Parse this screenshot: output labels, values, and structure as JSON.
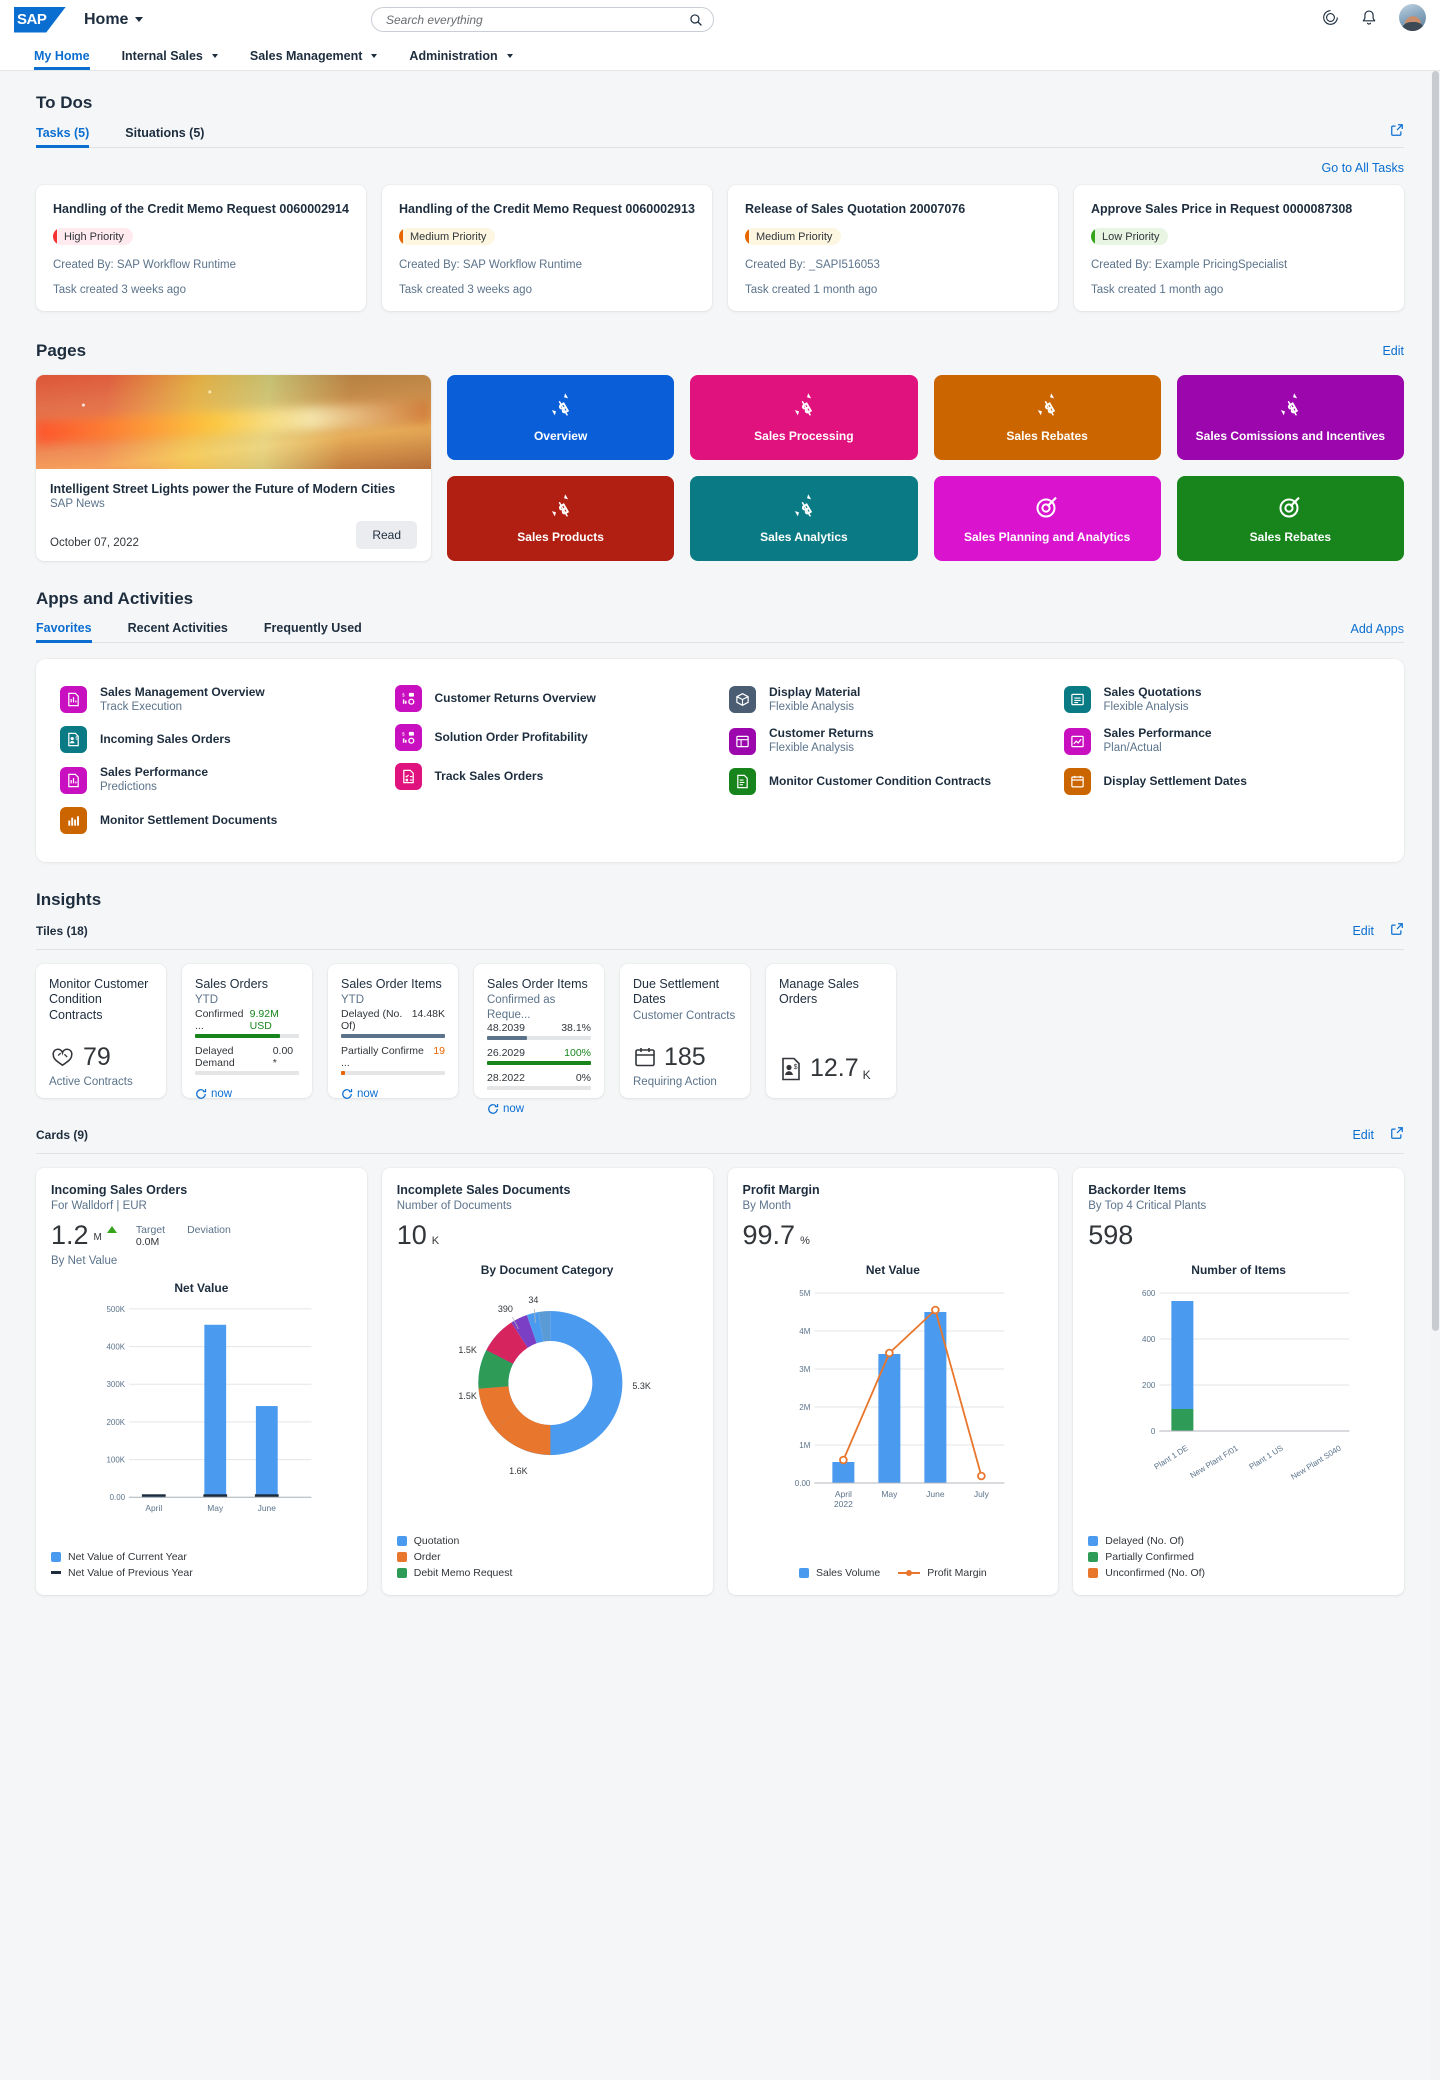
{
  "shell": {
    "logo_text": "SAP",
    "home_title": "Home",
    "search_placeholder": "Search everything",
    "icons": [
      "target-icon",
      "bell-icon",
      "avatar"
    ]
  },
  "nav": {
    "items": [
      {
        "label": "My Home",
        "active": true,
        "has_caret": false
      },
      {
        "label": "Internal Sales",
        "active": false,
        "has_caret": true
      },
      {
        "label": "Sales Management",
        "active": false,
        "has_caret": true
      },
      {
        "label": "Administration",
        "active": false,
        "has_caret": true
      }
    ]
  },
  "todos": {
    "title": "To Dos",
    "tabs": [
      {
        "label": "Tasks (5)",
        "active": true
      },
      {
        "label": "Situations (5)",
        "active": false
      }
    ],
    "go_all_link": "Go to All Tasks",
    "cards": [
      {
        "title": "Handling of the Credit Memo Request 0060002914",
        "priority": "High Priority",
        "priority_level": "high",
        "created_by": "Created By: SAP Workflow Runtime",
        "created_ago": "Task created 3 weeks ago"
      },
      {
        "title": "Handling of the Credit Memo Request 0060002913",
        "priority": "Medium Priority",
        "priority_level": "medium",
        "created_by": "Created By: SAP Workflow Runtime",
        "created_ago": "Task created 3 weeks ago"
      },
      {
        "title": "Release of Sales Quotation 20007076",
        "priority": "Medium Priority",
        "priority_level": "medium",
        "created_by": "Created By: _SAPI516053",
        "created_ago": "Task created 1 month ago"
      },
      {
        "title": "Approve Sales Price in Request 0000087308",
        "priority": "Low Priority",
        "priority_level": "low",
        "created_by": "Created By: Example PricingSpecialist",
        "created_ago": "Task created 1 month ago"
      }
    ]
  },
  "pages": {
    "title": "Pages",
    "edit_label": "Edit",
    "news": {
      "title": "Intelligent Street Lights power the Future of Modern Cities",
      "source": "SAP News",
      "date": "October 07, 2022",
      "read_label": "Read"
    },
    "tiles": [
      {
        "label": "Overview",
        "color": "#0a5ed8",
        "icon": "sales-icon"
      },
      {
        "label": "Sales Processing",
        "color": "#e0127e",
        "icon": "sales-icon"
      },
      {
        "label": "Sales Rebates",
        "color": "#cb6500",
        "icon": "sales-icon"
      },
      {
        "label": "Sales Comissions and Incentives",
        "color": "#9b06ad",
        "icon": "sales-icon"
      },
      {
        "label": "Sales Products",
        "color": "#b11e12",
        "icon": "sales-icon"
      },
      {
        "label": "Sales Analytics",
        "color": "#0a7b84",
        "icon": "sales-icon"
      },
      {
        "label": "Sales Planning and Analytics",
        "color": "#da13cf",
        "icon": "target-icon"
      },
      {
        "label": "Sales Rebates",
        "color": "#18851c",
        "icon": "target-icon"
      }
    ]
  },
  "apps": {
    "title": "Apps and Activities",
    "tabs": [
      {
        "label": "Favorites",
        "active": true
      },
      {
        "label": "Recent Activities",
        "active": false
      },
      {
        "label": "Frequently Used",
        "active": false
      }
    ],
    "add_apps_label": "Add Apps",
    "columns": [
      [
        {
          "name": "Sales Management Overview",
          "sub": "Track Execution",
          "color": "#c910c1",
          "icon": "chart-doc-icon"
        },
        {
          "name": "Incoming Sales Orders",
          "sub": "",
          "color": "#0a7b84",
          "icon": "order-person-icon"
        },
        {
          "name": "Sales Performance",
          "sub": "Predictions",
          "color": "#c910c1",
          "icon": "chart-doc-icon"
        },
        {
          "name": "Monitor Settlement Documents",
          "sub": "",
          "color": "#cb6500",
          "icon": "bar-chart-icon"
        }
      ],
      [
        {
          "name": "Customer Returns Overview",
          "sub": "",
          "color": "#c910c1",
          "icon": "returns-icon"
        },
        {
          "name": "Solution Order Profitability",
          "sub": "",
          "color": "#c910c1",
          "icon": "returns-icon"
        },
        {
          "name": "Track Sales Orders",
          "sub": "",
          "color": "#e0127e",
          "icon": "checklist-icon"
        }
      ],
      [
        {
          "name": "Display Material",
          "sub": "Flexible Analysis",
          "color": "#4a5d73",
          "icon": "material-icon"
        },
        {
          "name": "Customer Returns",
          "sub": "Flexible Analysis",
          "color": "#9b06ad",
          "icon": "grid-icon"
        },
        {
          "name": "Monitor Customer Condition Contracts",
          "sub": "",
          "color": "#18851c",
          "icon": "contract-icon"
        }
      ],
      [
        {
          "name": "Sales Quotations",
          "sub": "Flexible Analysis",
          "color": "#0a7b84",
          "icon": "quote-icon"
        },
        {
          "name": "Sales Performance",
          "sub": "Plan/Actual",
          "color": "#c910c1",
          "icon": "perf-icon"
        },
        {
          "name": "Display Settlement Dates",
          "sub": "",
          "color": "#cb6500",
          "icon": "calendar-icon"
        }
      ]
    ]
  },
  "insights": {
    "title": "Insights",
    "tiles_label": "Tiles (18)",
    "cards_label": "Cards (9)",
    "edit_label": "Edit",
    "tiles": [
      {
        "type": "numeric",
        "title": "Monitor Customer Condition Contracts",
        "sub": "",
        "icon": "contract-icon",
        "value": "79",
        "unit": "",
        "footer": "Active Contracts"
      },
      {
        "type": "bullets",
        "title": "Sales Orders",
        "sub": "YTD",
        "rows": [
          {
            "label": "Confirmed ...",
            "value": "9.92M USD",
            "pct": 82,
            "color": "#18851c",
            "value_color": "#18851c"
          },
          {
            "label": "Delayed Demand",
            "value": "0.00 *",
            "pct": 0,
            "color": "#18851c",
            "value_color": "#32363a"
          }
        ],
        "refresh": "now"
      },
      {
        "type": "bullets",
        "title": "Sales Order Items",
        "sub": "YTD",
        "rows": [
          {
            "label": "Delayed (No. Of)",
            "value": "14.48K",
            "pct": 100,
            "color": "#5b738b",
            "value_color": "#32363a"
          },
          {
            "label": "Partially Confirme ...",
            "value": "19",
            "pct": 4,
            "color": "#e76500",
            "value_color": "#e76500"
          }
        ],
        "refresh": "now"
      },
      {
        "type": "bullets",
        "title": "Sales Order Items",
        "sub": "Confirmed as Reque...",
        "rows": [
          {
            "label": "48.2039",
            "value": "38.1%",
            "pct": 38,
            "color": "#5b738b",
            "value_color": "#32363a"
          },
          {
            "label": "26.2029",
            "value": "100%",
            "pct": 100,
            "color": "#18851c",
            "value_color": "#18851c"
          },
          {
            "label": "28.2022",
            "value": "0%",
            "pct": 0,
            "color": "#5b738b",
            "value_color": "#32363a"
          }
        ],
        "refresh": "now"
      },
      {
        "type": "numeric",
        "title": "Due Settlement Dates",
        "sub": "Customer Contracts",
        "icon": "calendar-icon",
        "value": "185",
        "unit": "",
        "footer": "Requiring Action"
      },
      {
        "type": "numeric",
        "title": "Manage Sales Orders",
        "sub": "",
        "icon": "order-person-icon",
        "value": "12.7",
        "unit": "K",
        "footer": ""
      }
    ]
  },
  "chart_data": [
    {
      "type": "bar",
      "card_title": "Incoming Sales Orders",
      "card_sub": "For Walldorf | EUR",
      "kpi_value": "1.2",
      "kpi_unit_top": "M",
      "kpi_trend": "up",
      "kpi_caption": "By Net Value",
      "meta": [
        {
          "label": "Target",
          "value": "0.0M"
        },
        {
          "label": "Deviation",
          "value": ""
        }
      ],
      "title": "Net Value",
      "xlabel": "",
      "ylabel": "",
      "categories": [
        "April",
        "May",
        "June"
      ],
      "series": [
        {
          "name": "Net Value of Current Year",
          "color": "#4a9bf0",
          "values": [
            2000,
            458000,
            243000
          ]
        },
        {
          "name": "Net Value of Previous Year",
          "color": "#1d2d3e",
          "values": [
            3000,
            3000,
            3000
          ]
        }
      ],
      "ylim": [
        0,
        500000
      ],
      "yticks": [
        "0.00",
        "100K",
        "200K",
        "300K",
        "400K",
        "500K"
      ],
      "grid": true,
      "legend": "bottom-left"
    },
    {
      "type": "pie",
      "card_title": "Incomplete Sales Documents",
      "card_sub": "Number of Documents",
      "kpi_value": "10",
      "kpi_unit_top": "K",
      "title": "By Document Category",
      "labels": [
        "Quotation",
        "Order",
        "Debit Memo Request",
        "slice-4",
        "slice-5",
        "slice-6"
      ],
      "values": [
        5300,
        1600,
        1500,
        390,
        34,
        1500
      ],
      "value_labels": [
        "5.3K",
        "1.6K",
        "1.5K",
        "390",
        "34",
        "1.5K"
      ],
      "colors": [
        "#4a9bf0",
        "#e8762c",
        "#2e9b57",
        "#d6245f",
        "#7a3fc4",
        "#4a9bf0"
      ],
      "legend": "bottom-left",
      "legend_items": [
        {
          "label": "Quotation",
          "color": "#4a9bf0"
        },
        {
          "label": "Order",
          "color": "#e8762c"
        },
        {
          "label": "Debit Memo Request",
          "color": "#2e9b57"
        }
      ]
    },
    {
      "type": "combo",
      "card_title": "Profit Margin",
      "card_sub": "By Month",
      "kpi_value": "99.7",
      "kpi_unit_top": "%",
      "title": "Net Value",
      "categories": [
        "April\n2022",
        "May",
        "June",
        "July"
      ],
      "category_labels": [
        "April",
        "May",
        "June",
        "July"
      ],
      "category_sub": [
        "2022",
        "",
        "",
        ""
      ],
      "series": [
        {
          "name": "Sales Volume",
          "type": "bar",
          "color": "#4a9bf0",
          "values": [
            550000,
            3400000,
            4500000,
            0
          ]
        },
        {
          "name": "Profit Margin",
          "type": "line",
          "color": "#e8762c",
          "values": [
            600000,
            3400000,
            4550000,
            180000
          ]
        }
      ],
      "ylim": [
        0,
        5000000
      ],
      "yticks": [
        "0.00",
        "1M",
        "2M",
        "3M",
        "4M",
        "5M"
      ],
      "grid": true,
      "legend": "bottom"
    },
    {
      "type": "bar",
      "card_title": "Backorder Items",
      "card_sub": "By Top 4 Critical Plants",
      "kpi_value": "598",
      "kpi_unit_top": "",
      "title": "Number of Items",
      "categories": [
        "Plant 1 DE",
        "New Plant F/01",
        "Plant 1 US",
        "New Plant S040"
      ],
      "series": [
        {
          "name": "Delayed (No. Of)",
          "color": "#4a9bf0",
          "values": [
            510,
            0,
            0,
            0
          ]
        },
        {
          "name": "Partially Confirmed",
          "color": "#2e9b57",
          "values": [
            88,
            0,
            0,
            0
          ]
        },
        {
          "name": "Unconfirmed (No. Of)",
          "color": "#e8762c",
          "values": [
            0,
            0,
            0,
            0
          ]
        }
      ],
      "ylim": [
        0,
        600
      ],
      "yticks": [
        "0",
        "200",
        "400",
        "600"
      ],
      "grid": true,
      "legend": "bottom-left",
      "stacked": true
    }
  ]
}
